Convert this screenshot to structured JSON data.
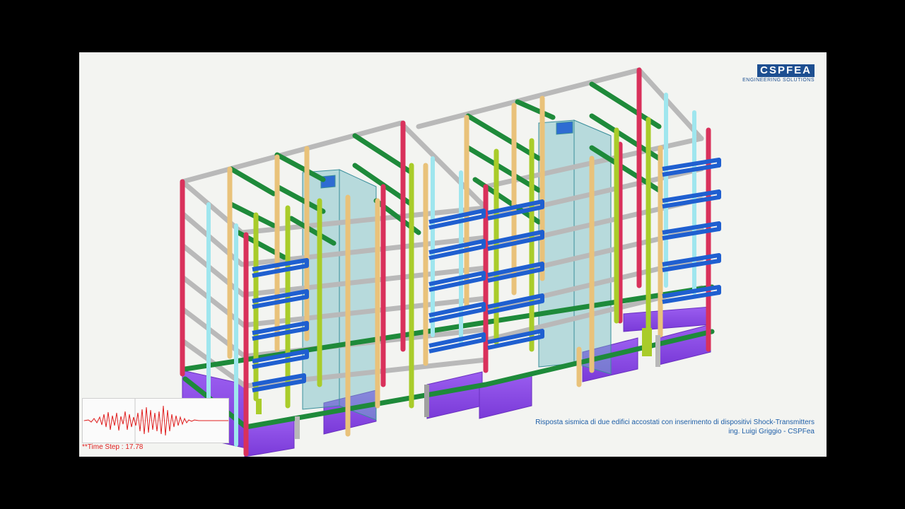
{
  "viewport": {
    "logo": {
      "name": "CSPFEA",
      "tagline": "ENGINEERING SOLUTIONS"
    },
    "caption": {
      "line1": "Risposta sismica di due edifici accostati con inserimento di dispositivi Shock-Transmitters",
      "line2": "ing. Luigi Griggio - CSPFea"
    },
    "time_step": "**Time Step : 17.78",
    "colors": {
      "background": "#f3f4f1",
      "beam_grey": "#b8b8b8",
      "beam_green": "#1e8a3a",
      "column_red": "#d9315b",
      "column_yellow": "#e9c27a",
      "column_lime": "#a9cc2a",
      "column_cyan": "#9fe6ee",
      "shock_transmitter_blue": "#1f5fd0",
      "foundation_purple": "#8a4ae6",
      "core_glass": "#6fbac4",
      "seismogram": "#e02020"
    }
  }
}
